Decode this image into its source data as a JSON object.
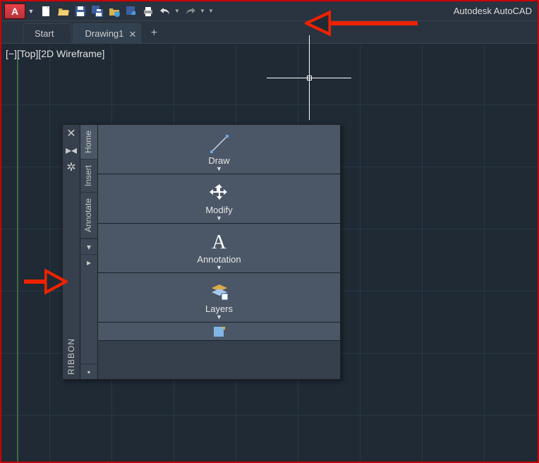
{
  "titlebar": {
    "app_letter": "A",
    "title_text": "Autodesk AutoCAD"
  },
  "qat": {
    "items": [
      {
        "name": "new-icon"
      },
      {
        "name": "open-icon"
      },
      {
        "name": "save-icon"
      },
      {
        "name": "saveas-icon"
      },
      {
        "name": "openweb-icon"
      },
      {
        "name": "savecloud-icon"
      },
      {
        "name": "plot-icon"
      },
      {
        "name": "undo-icon"
      },
      {
        "name": "redo-icon"
      }
    ]
  },
  "doctabs": {
    "start": "Start",
    "drawing": "Drawing1"
  },
  "viewport": {
    "view_label": "[−][Top][2D Wireframe]"
  },
  "ribbon": {
    "side_label": "RIBBON",
    "tabs": {
      "home": "Home",
      "insert": "Insert",
      "annotate": "Annotate"
    },
    "panels": {
      "draw": "Draw",
      "modify": "Modify",
      "annotation": "Annotation",
      "layers": "Layers"
    }
  }
}
